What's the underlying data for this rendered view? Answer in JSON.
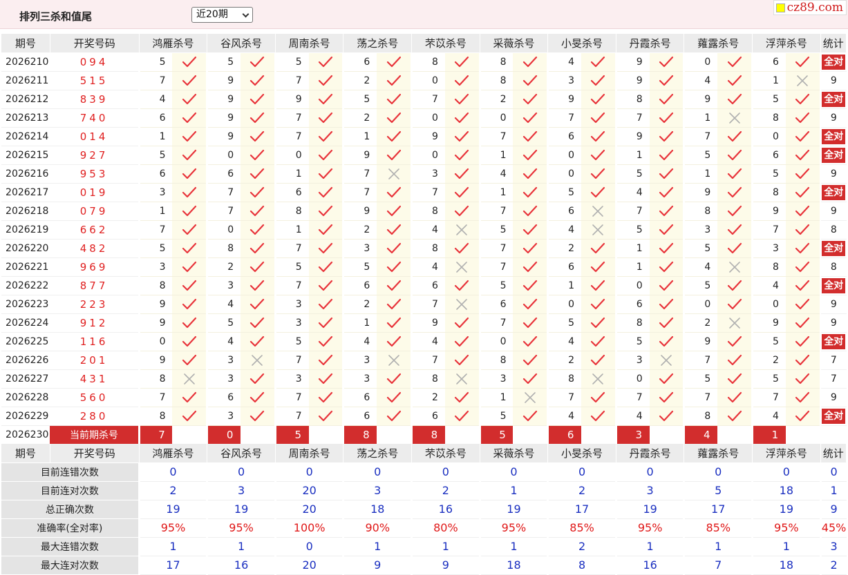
{
  "header": {
    "title": "排列三杀和值尾",
    "period_select": "近20期",
    "site_logo": "cz89.com"
  },
  "columns": {
    "issue": "期号",
    "draw": "开奖号码",
    "experts": [
      "鸿雁杀号",
      "谷风杀号",
      "周南杀号",
      "荡之杀号",
      "芣苡杀号",
      "采薇杀号",
      "小旻杀号",
      "丹霞杀号",
      "蕹露杀号",
      "浮萍杀号"
    ],
    "stat": "统计"
  },
  "rows": [
    {
      "issue": "2026210",
      "draw": "094",
      "kills": [
        5,
        5,
        5,
        6,
        8,
        8,
        4,
        9,
        0,
        6
      ],
      "hits": [
        1,
        1,
        1,
        1,
        1,
        1,
        1,
        1,
        1,
        1
      ],
      "stat": "全对"
    },
    {
      "issue": "2026211",
      "draw": "515",
      "kills": [
        7,
        9,
        7,
        2,
        0,
        8,
        3,
        9,
        4,
        1
      ],
      "hits": [
        1,
        1,
        1,
        1,
        1,
        1,
        1,
        1,
        1,
        0
      ],
      "stat": "9"
    },
    {
      "issue": "2026212",
      "draw": "839",
      "kills": [
        4,
        9,
        9,
        5,
        7,
        2,
        9,
        8,
        9,
        5
      ],
      "hits": [
        1,
        1,
        1,
        1,
        1,
        1,
        1,
        1,
        1,
        1
      ],
      "stat": "全对"
    },
    {
      "issue": "2026213",
      "draw": "740",
      "kills": [
        6,
        9,
        7,
        2,
        0,
        0,
        7,
        7,
        1,
        8
      ],
      "hits": [
        1,
        1,
        1,
        1,
        1,
        1,
        1,
        1,
        0,
        1
      ],
      "stat": "9"
    },
    {
      "issue": "2026214",
      "draw": "014",
      "kills": [
        1,
        9,
        7,
        1,
        9,
        7,
        6,
        9,
        7,
        0
      ],
      "hits": [
        1,
        1,
        1,
        1,
        1,
        1,
        1,
        1,
        1,
        1
      ],
      "stat": "全对"
    },
    {
      "issue": "2026215",
      "draw": "927",
      "kills": [
        5,
        0,
        0,
        9,
        0,
        1,
        0,
        1,
        5,
        6
      ],
      "hits": [
        1,
        1,
        1,
        1,
        1,
        1,
        1,
        1,
        1,
        1
      ],
      "stat": "全对"
    },
    {
      "issue": "2026216",
      "draw": "953",
      "kills": [
        6,
        6,
        1,
        7,
        3,
        4,
        0,
        5,
        1,
        5
      ],
      "hits": [
        1,
        1,
        1,
        0,
        1,
        1,
        1,
        1,
        1,
        1
      ],
      "stat": "9"
    },
    {
      "issue": "2026217",
      "draw": "019",
      "kills": [
        3,
        7,
        6,
        7,
        7,
        1,
        5,
        4,
        9,
        8
      ],
      "hits": [
        1,
        1,
        1,
        1,
        1,
        1,
        1,
        1,
        1,
        1
      ],
      "stat": "全对"
    },
    {
      "issue": "2026218",
      "draw": "079",
      "kills": [
        1,
        7,
        8,
        9,
        8,
        7,
        6,
        7,
        8,
        9
      ],
      "hits": [
        1,
        1,
        1,
        1,
        1,
        1,
        0,
        1,
        1,
        1
      ],
      "stat": "9"
    },
    {
      "issue": "2026219",
      "draw": "662",
      "kills": [
        7,
        0,
        1,
        2,
        4,
        5,
        4,
        5,
        3,
        7
      ],
      "hits": [
        1,
        1,
        1,
        1,
        0,
        1,
        0,
        1,
        1,
        1
      ],
      "stat": "8"
    },
    {
      "issue": "2026220",
      "draw": "482",
      "kills": [
        5,
        8,
        7,
        3,
        8,
        7,
        2,
        1,
        5,
        3
      ],
      "hits": [
        1,
        1,
        1,
        1,
        1,
        1,
        1,
        1,
        1,
        1
      ],
      "stat": "全对"
    },
    {
      "issue": "2026221",
      "draw": "969",
      "kills": [
        3,
        2,
        5,
        5,
        4,
        7,
        6,
        1,
        4,
        8
      ],
      "hits": [
        1,
        1,
        1,
        1,
        0,
        1,
        1,
        1,
        0,
        1
      ],
      "stat": "8"
    },
    {
      "issue": "2026222",
      "draw": "877",
      "kills": [
        8,
        3,
        7,
        6,
        6,
        5,
        1,
        0,
        5,
        4
      ],
      "hits": [
        1,
        1,
        1,
        1,
        1,
        1,
        1,
        1,
        1,
        1
      ],
      "stat": "全对"
    },
    {
      "issue": "2026223",
      "draw": "223",
      "kills": [
        9,
        4,
        3,
        2,
        7,
        6,
        0,
        6,
        0,
        0
      ],
      "hits": [
        1,
        1,
        1,
        1,
        0,
        1,
        1,
        1,
        1,
        1
      ],
      "stat": "9"
    },
    {
      "issue": "2026224",
      "draw": "912",
      "kills": [
        9,
        5,
        3,
        1,
        9,
        7,
        5,
        8,
        2,
        9
      ],
      "hits": [
        1,
        1,
        1,
        1,
        1,
        1,
        1,
        1,
        0,
        1
      ],
      "stat": "9"
    },
    {
      "issue": "2026225",
      "draw": "116",
      "kills": [
        0,
        4,
        5,
        4,
        4,
        0,
        4,
        5,
        9,
        5
      ],
      "hits": [
        1,
        1,
        1,
        1,
        1,
        1,
        1,
        1,
        1,
        1
      ],
      "stat": "全对"
    },
    {
      "issue": "2026226",
      "draw": "201",
      "kills": [
        9,
        3,
        7,
        3,
        7,
        8,
        2,
        3,
        7,
        2
      ],
      "hits": [
        1,
        0,
        1,
        0,
        1,
        1,
        1,
        0,
        1,
        1
      ],
      "stat": "7"
    },
    {
      "issue": "2026227",
      "draw": "431",
      "kills": [
        8,
        3,
        3,
        3,
        8,
        3,
        8,
        0,
        5,
        5
      ],
      "hits": [
        0,
        1,
        1,
        1,
        0,
        1,
        0,
        1,
        1,
        1
      ],
      "stat": "7"
    },
    {
      "issue": "2026228",
      "draw": "560",
      "kills": [
        7,
        6,
        7,
        6,
        2,
        1,
        7,
        7,
        7,
        7
      ],
      "hits": [
        1,
        1,
        1,
        1,
        1,
        0,
        1,
        1,
        1,
        1
      ],
      "stat": "9"
    },
    {
      "issue": "2026229",
      "draw": "280",
      "kills": [
        8,
        3,
        7,
        6,
        6,
        5,
        4,
        4,
        8,
        4
      ],
      "hits": [
        1,
        1,
        1,
        1,
        1,
        1,
        1,
        1,
        1,
        1
      ],
      "stat": "全对"
    }
  ],
  "current": {
    "issue": "2026230",
    "label": "当前期杀号",
    "kills": [
      7,
      0,
      5,
      8,
      8,
      5,
      6,
      3,
      4,
      1
    ]
  },
  "summary": [
    {
      "label": "目前连错次数",
      "values": [
        "0",
        "0",
        "0",
        "0",
        "0",
        "0",
        "0",
        "0",
        "0",
        "0"
      ],
      "stat": "0",
      "red": false
    },
    {
      "label": "目前连对次数",
      "values": [
        "2",
        "3",
        "20",
        "3",
        "2",
        "1",
        "2",
        "3",
        "5",
        "18"
      ],
      "stat": "1",
      "red": false
    },
    {
      "label": "总正确次数",
      "values": [
        "19",
        "19",
        "20",
        "18",
        "16",
        "19",
        "17",
        "19",
        "17",
        "19"
      ],
      "stat": "9",
      "red": false
    },
    {
      "label": "准确率(全对率)",
      "values": [
        "95%",
        "95%",
        "100%",
        "90%",
        "80%",
        "95%",
        "85%",
        "95%",
        "85%",
        "95%"
      ],
      "stat": "45%",
      "red": true
    },
    {
      "label": "最大连错次数",
      "values": [
        "1",
        "1",
        "0",
        "1",
        "1",
        "1",
        "2",
        "1",
        "1",
        "1"
      ],
      "stat": "3",
      "red": false
    },
    {
      "label": "最大连对次数",
      "values": [
        "17",
        "16",
        "20",
        "9",
        "9",
        "18",
        "8",
        "16",
        "7",
        "18"
      ],
      "stat": "2",
      "red": false
    }
  ],
  "icons": {
    "hit": "check-icon",
    "miss": "cross-icon"
  },
  "colors": {
    "check": "#e8333a",
    "cross": "#b0b0b0",
    "badge": "#d22d2d",
    "summary_blue": "#1a2fc0",
    "summary_red": "#e01818",
    "draw": "#e02020"
  }
}
